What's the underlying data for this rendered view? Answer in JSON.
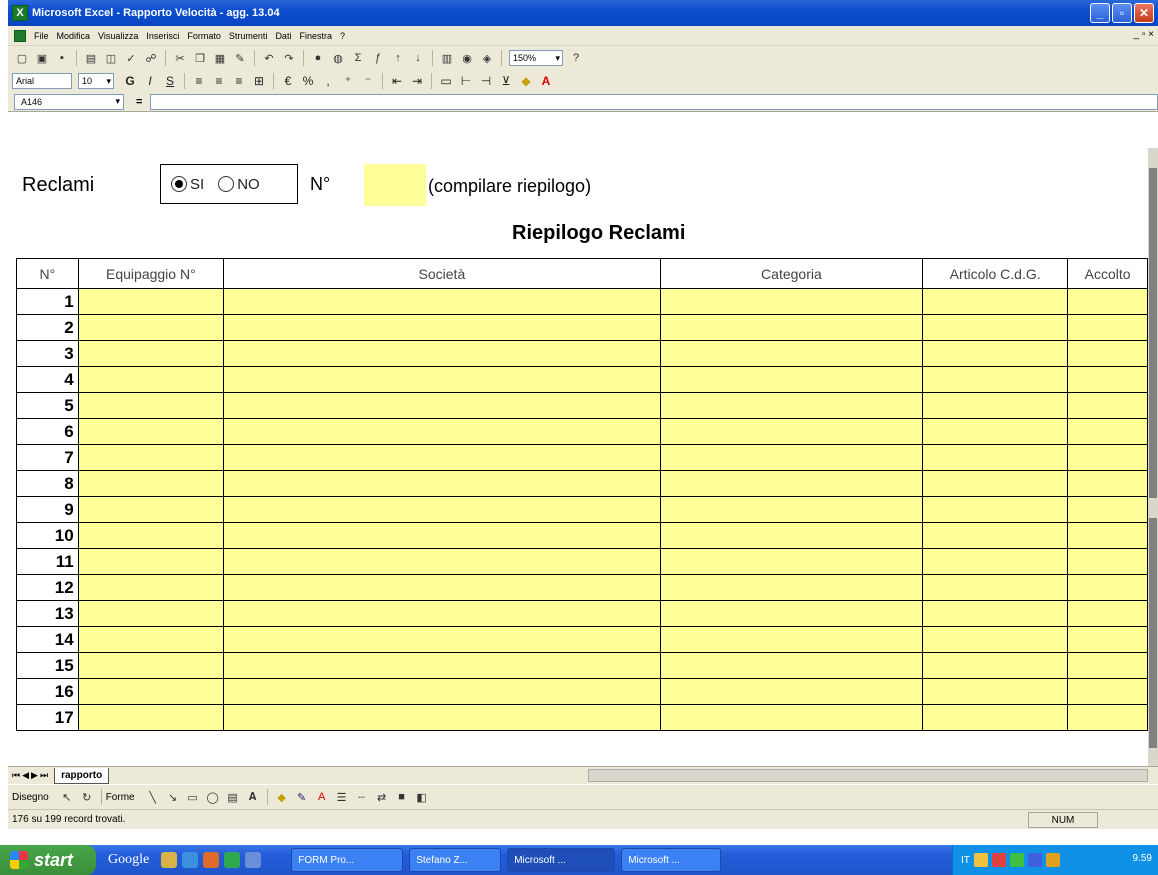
{
  "window": {
    "app_icon": "X",
    "title": "Microsoft Excel - Rapporto Velocità - agg. 13.04",
    "minimize_label": "_",
    "maximize_label": "▫",
    "close_label": "✕"
  },
  "menu": {
    "items": [
      "File",
      "Modifica",
      "Visualizza",
      "Inserisci",
      "Formato",
      "Strumenti",
      "Dati",
      "Finestra",
      "?"
    ],
    "doc_controls": "_ ▫ ×"
  },
  "toolbar": {
    "zoom": "150%",
    "font_name": "Arial",
    "font_size": "10"
  },
  "formula_bar": {
    "name_box": "A146",
    "equals": "="
  },
  "form": {
    "reclami_label": "Reclami",
    "radio_si_label": "SI",
    "radio_no_label": "NO",
    "radio_selected": "SI",
    "n_label": "N°",
    "n_value": "",
    "note": "(compilare riepilogo)",
    "summary_title": "Riepilogo Reclami"
  },
  "table": {
    "columns": [
      "N°",
      "Equipaggio N°",
      "Società",
      "Categoria",
      "Articolo C.d.G.",
      "Accolto"
    ],
    "row_numbers": [
      "1",
      "2",
      "3",
      "4",
      "5",
      "6",
      "7",
      "8",
      "9",
      "10",
      "11",
      "12",
      "13",
      "14",
      "15",
      "16",
      "17"
    ]
  },
  "sheets": {
    "active": "rapporto"
  },
  "drawing_bar": {
    "draw_label": "Disegno",
    "shapes_label": "Forme"
  },
  "status": {
    "message": "176 su 199 record trovati.",
    "num_indicator": "NUM"
  },
  "taskbar": {
    "start_label": "start",
    "google_label": "Google",
    "tasks": [
      {
        "label": "FORM Pro...",
        "active": false
      },
      {
        "label": "Stefano Z...",
        "active": false
      },
      {
        "label": "Microsoft ...",
        "active": true
      },
      {
        "label": "Microsoft ...",
        "active": false
      }
    ],
    "tray_lang": "IT",
    "clock": "9.59"
  },
  "colors": {
    "input_fill": "#ffff99",
    "titlebar": "#0b4ed0",
    "chrome": "#ece9d8"
  }
}
